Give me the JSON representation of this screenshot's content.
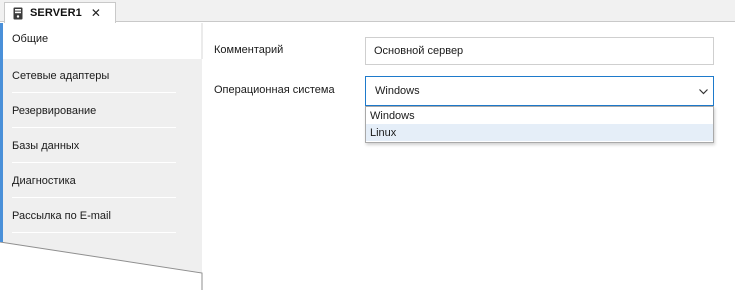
{
  "window": {
    "tab_title": "SERVER1",
    "tab_icon": "server-icon",
    "close_icon": "close-icon"
  },
  "sidebar": {
    "items": [
      {
        "label": "Общие",
        "active": true
      },
      {
        "label": "Сетевые адаптеры",
        "active": false
      },
      {
        "label": "Резервирование",
        "active": false
      },
      {
        "label": "Базы данных",
        "active": false
      },
      {
        "label": "Диагностика",
        "active": false
      },
      {
        "label": "Рассылка по E-mail",
        "active": false
      }
    ]
  },
  "form": {
    "comment": {
      "label": "Комментарий",
      "value": "Основной сервер"
    },
    "os": {
      "label": "Операционная система",
      "value": "Windows",
      "options": [
        "Windows",
        "Linux"
      ],
      "highlighted": "Linux",
      "chevron_icon": "chevron-down-icon"
    }
  },
  "colors": {
    "accent": "#1e7acb",
    "nav_bg": "#efefef",
    "active_marker": "#4a90d9",
    "highlight": "#e5eef8"
  }
}
